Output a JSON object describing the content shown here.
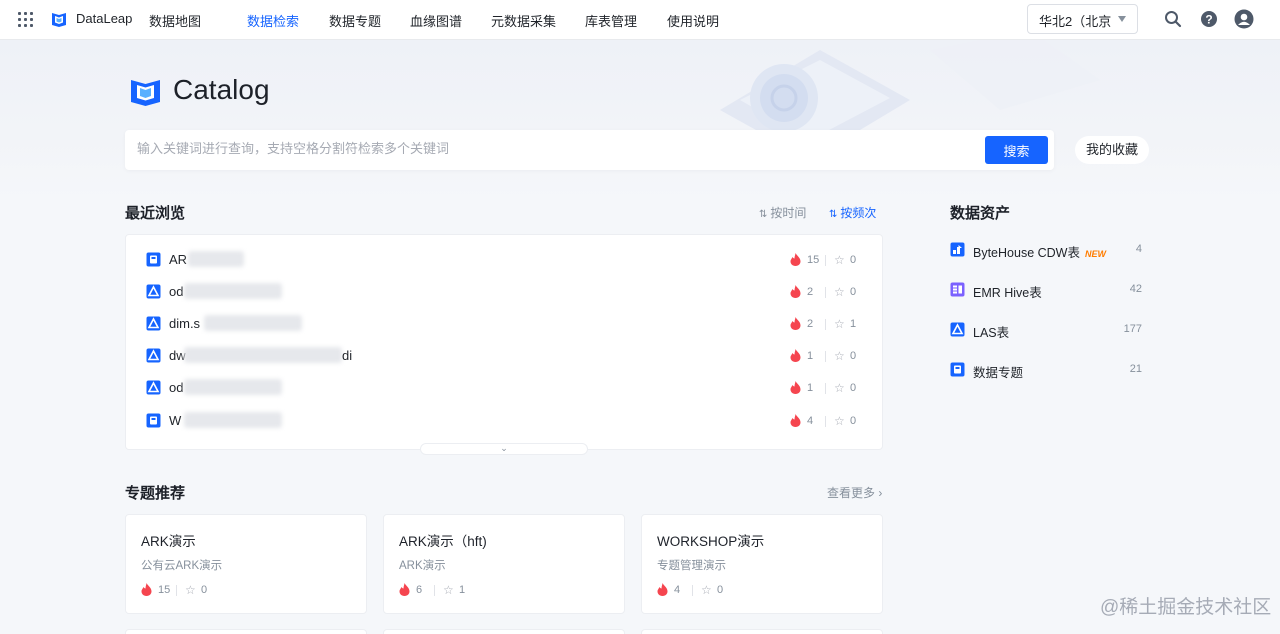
{
  "topbar": {
    "brand": "DataLeap",
    "nav": [
      "数据地图",
      "数据检索",
      "数据专题",
      "血缘图谱",
      "元数据采集",
      "库表管理",
      "使用说明"
    ],
    "active_nav": "数据检索",
    "region": "华北2（北京"
  },
  "hero": {
    "title": "Catalog",
    "search_placeholder": "输入关键词进行查询，支持空格分割符检索多个关键词",
    "search_button": "搜索",
    "favorites_button": "我的收藏"
  },
  "recent": {
    "title": "最近浏览",
    "sort_by_time": "按时间",
    "sort_by_frequency": "按频次",
    "rows": [
      {
        "icon": "topic-icon",
        "name_visible": "AR",
        "tail": "",
        "hot": "15",
        "fav": "0"
      },
      {
        "icon": "las-table-icon",
        "name_visible": "od",
        "tail": "",
        "hot": "2",
        "fav": "0"
      },
      {
        "icon": "las-table-icon",
        "name_visible": "dim.s",
        "tail": "",
        "hot": "2",
        "fav": "1"
      },
      {
        "icon": "las-table-icon",
        "name_visible": "dw",
        "tail": "di",
        "hot": "1",
        "fav": "0"
      },
      {
        "icon": "las-table-icon",
        "name_visible": "od",
        "tail": "",
        "hot": "1",
        "fav": "0"
      },
      {
        "icon": "topic-icon",
        "name_visible": "W",
        "tail": "",
        "hot": "4",
        "fav": "0"
      }
    ]
  },
  "assets": {
    "title": "数据资产",
    "items": [
      {
        "name": "ByteHouse CDW表",
        "badge": "NEW",
        "count": "4",
        "color": "#1664ff"
      },
      {
        "name": "EMR Hive表",
        "badge": "",
        "count": "42",
        "color": "#7b61ff"
      },
      {
        "name": "LAS表",
        "badge": "",
        "count": "177",
        "color": "#1664ff"
      },
      {
        "name": "数据专题",
        "badge": "",
        "count": "21",
        "color": "#1664ff"
      }
    ]
  },
  "topics": {
    "title": "专题推荐",
    "more": "查看更多",
    "cards": [
      {
        "name": "ARK演示",
        "desc": "公有云ARK演示",
        "hot": "15",
        "fav": "0"
      },
      {
        "name": "ARK演示（hft)",
        "desc": "ARK演示",
        "hot": "6",
        "fav": "1"
      },
      {
        "name": "WORKSHOP演示",
        "desc": "专题管理演示",
        "hot": "4",
        "fav": "0"
      }
    ]
  },
  "watermark": "@稀土掘金技术社区",
  "colors": {
    "primary": "#1664ff",
    "hot": "#f5454f",
    "new_badge": "#ff7d00"
  }
}
